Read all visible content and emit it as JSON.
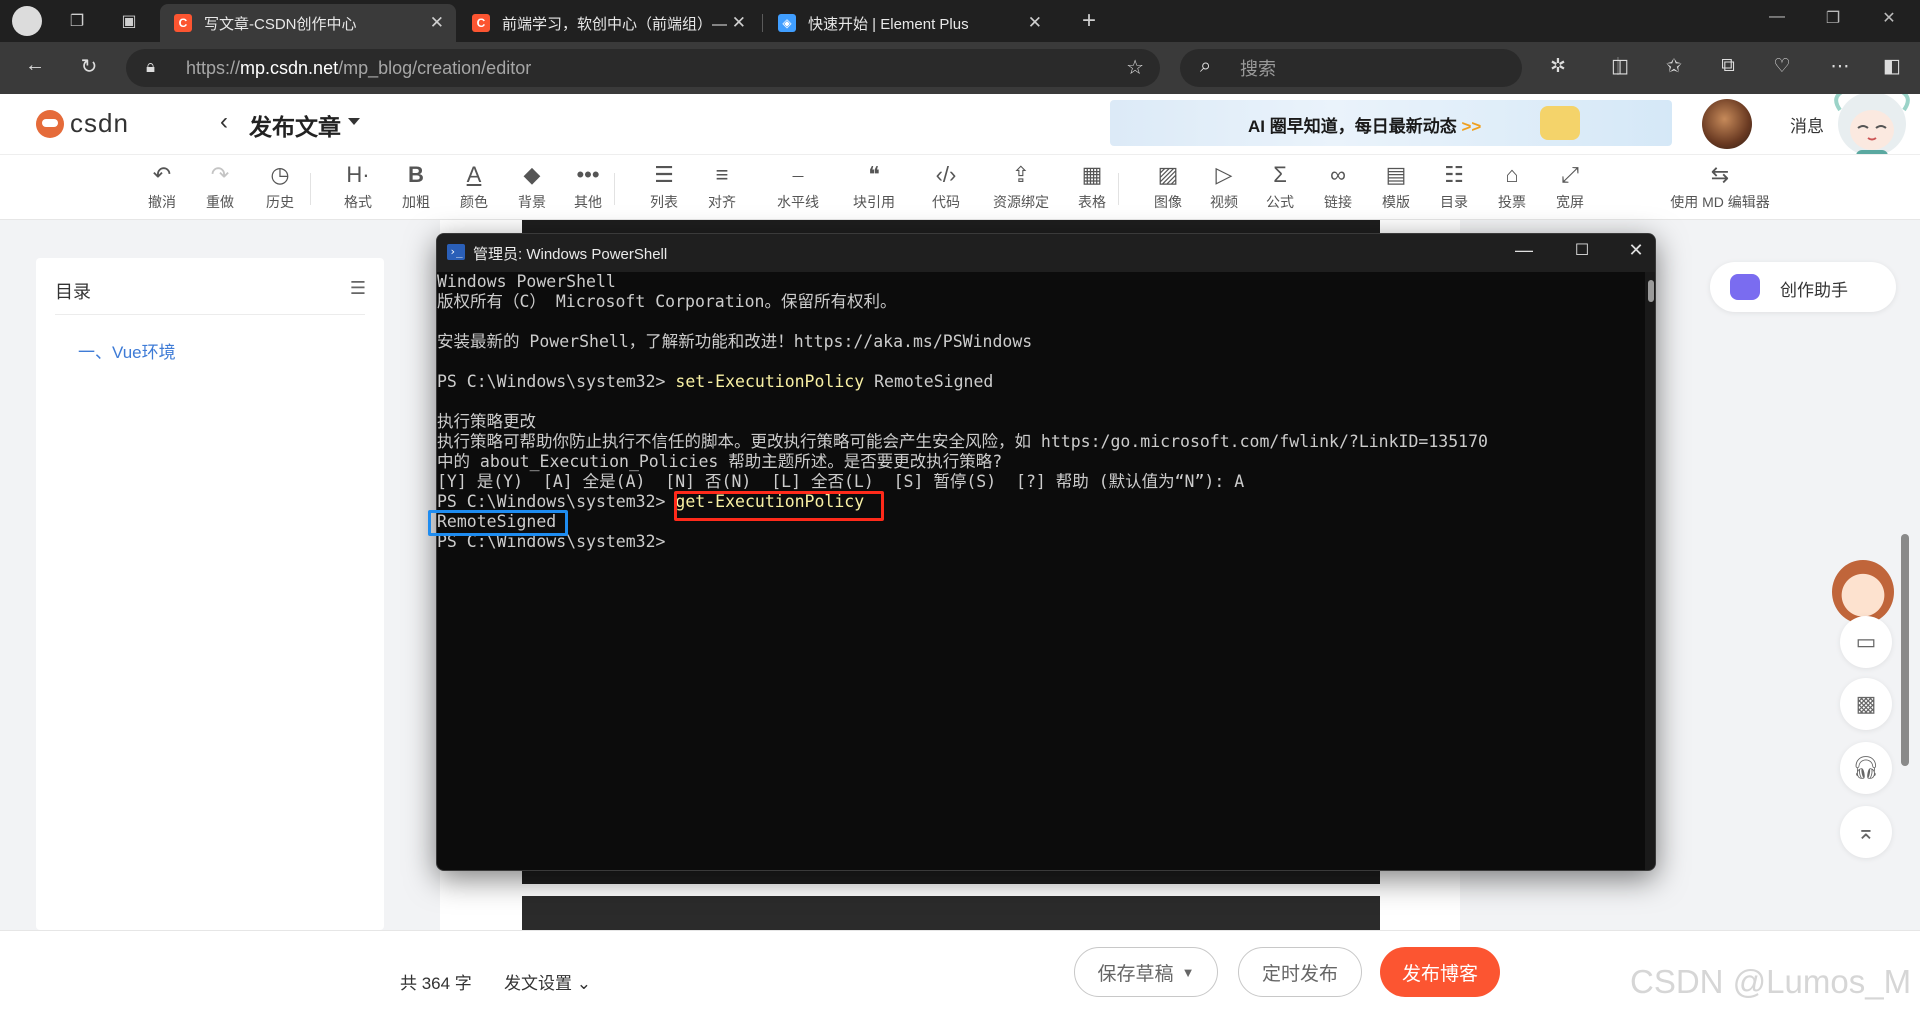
{
  "browser": {
    "tabs": [
      {
        "title": "写文章-CSDN创作中心",
        "favicon_color": "#fc5531",
        "active": true
      },
      {
        "title": "前端学习，软创中心（前端组）— ",
        "favicon_color": "#fc5531",
        "active": false
      },
      {
        "title": "快速开始 | Element Plus",
        "favicon_color": "#409eff",
        "active": false
      }
    ],
    "url": {
      "prefix": "https://",
      "host": "mp.csdn.net",
      "path": "/mp_blog/creation/editor"
    },
    "search_placeholder": "搜索"
  },
  "header": {
    "logo_text": "csdn",
    "page_title": "发布文章",
    "banner_text": "AI 圈早知道，每日最新动态",
    "banner_arrows": ">>",
    "messages_label": "消息"
  },
  "toolbar": [
    {
      "id": "undo",
      "label": "撤消",
      "icon": "undo-icon",
      "glyph": "↶"
    },
    {
      "id": "redo",
      "label": "重做",
      "icon": "redo-icon",
      "glyph": "↷",
      "disabled": true
    },
    {
      "id": "history",
      "label": "历史",
      "icon": "history-icon",
      "glyph": "◷"
    },
    {
      "id": "format",
      "label": "格式",
      "icon": "heading-icon",
      "glyph": "H·"
    },
    {
      "id": "bold",
      "label": "加粗",
      "icon": "bold-icon",
      "glyph": "B"
    },
    {
      "id": "color",
      "label": "颜色",
      "icon": "text-color-icon",
      "glyph": "A"
    },
    {
      "id": "background",
      "label": "背景",
      "icon": "paint-bucket-icon",
      "glyph": "◆"
    },
    {
      "id": "more",
      "label": "其他",
      "icon": "more-icon",
      "glyph": "•••"
    },
    {
      "id": "list",
      "label": "列表",
      "icon": "list-icon",
      "glyph": "☰"
    },
    {
      "id": "align",
      "label": "对齐",
      "icon": "align-icon",
      "glyph": "≡"
    },
    {
      "id": "hr",
      "label": "水平线",
      "icon": "horizontal-rule-icon",
      "glyph": "⎯"
    },
    {
      "id": "quote",
      "label": "块引用",
      "icon": "quote-icon",
      "glyph": "❝"
    },
    {
      "id": "code",
      "label": "代码",
      "icon": "code-icon",
      "glyph": "‹/›"
    },
    {
      "id": "resource",
      "label": "资源绑定",
      "icon": "upload-icon",
      "glyph": "⇪"
    },
    {
      "id": "table",
      "label": "表格",
      "icon": "table-icon",
      "glyph": "▦"
    },
    {
      "id": "image",
      "label": "图像",
      "icon": "image-icon",
      "glyph": "▨"
    },
    {
      "id": "video",
      "label": "视频",
      "icon": "video-icon",
      "glyph": "▷"
    },
    {
      "id": "formula",
      "label": "公式",
      "icon": "sigma-icon",
      "glyph": "Σ"
    },
    {
      "id": "link",
      "label": "链接",
      "icon": "link-icon",
      "glyph": "∞"
    },
    {
      "id": "template",
      "label": "模版",
      "icon": "template-icon",
      "glyph": "▤"
    },
    {
      "id": "toc",
      "label": "目录",
      "icon": "toc-icon",
      "glyph": "☷"
    },
    {
      "id": "vote",
      "label": "投票",
      "icon": "vote-icon",
      "glyph": "⌂"
    },
    {
      "id": "wide",
      "label": "宽屏",
      "icon": "widescreen-icon",
      "glyph": "⤢"
    },
    {
      "id": "md",
      "label": "使用 MD 编辑器",
      "icon": "switch-icon",
      "glyph": "⇆"
    }
  ],
  "toc": {
    "title": "目录",
    "items": [
      "一、Vue环境"
    ]
  },
  "assistant_label": "创作助手",
  "powershell": {
    "title": "管理员: Windows PowerShell",
    "lines": [
      {
        "text": "Windows PowerShell"
      },
      {
        "text": "版权所有（C） Microsoft Corporation。保留所有权利。"
      },
      {
        "text": ""
      },
      {
        "text": "安装最新的 PowerShell，了解新功能和改进！https://aka.ms/PSWindows"
      },
      {
        "text": ""
      },
      {
        "prompt": "PS C:\\Windows\\system32> ",
        "cmd": "set-ExecutionPolicy",
        "args": " RemoteSigned"
      },
      {
        "text": ""
      },
      {
        "text": "执行策略更改"
      },
      {
        "text": "执行策略可帮助你防止执行不信任的脚本。更改执行策略可能会产生安全风险，如 https:/go.microsoft.com/fwlink/?LinkID=135170"
      },
      {
        "text": "中的 about_Execution_Policies 帮助主题所述。是否要更改执行策略?"
      },
      {
        "text": "[Y] 是(Y)  [A] 全是(A)  [N] 否(N)  [L] 全否(L)  [S] 暂停(S)  [?] 帮助 (默认值为“N”): A"
      },
      {
        "prompt": "PS C:\\Windows\\system32> ",
        "cmd": "get-ExecutionPolicy",
        "args": ""
      },
      {
        "text": "RemoteSigned"
      },
      {
        "prompt": "PS C:\\Windows\\system32> ",
        "cmd": "",
        "args": ""
      }
    ]
  },
  "footer": {
    "word_count": "共 364 字",
    "publish_settings": "发文设置",
    "save_draft": "保存草稿",
    "scheduled": "定时发布",
    "publish": "发布博客",
    "watermark": "CSDN @Lumos_M"
  },
  "colors": {
    "accent": "#fc5531",
    "link": "#3e7bd6",
    "highlight_red": "#ff2a1a",
    "highlight_blue": "#1e8cf0",
    "ps_command": "#f9f1a5"
  }
}
